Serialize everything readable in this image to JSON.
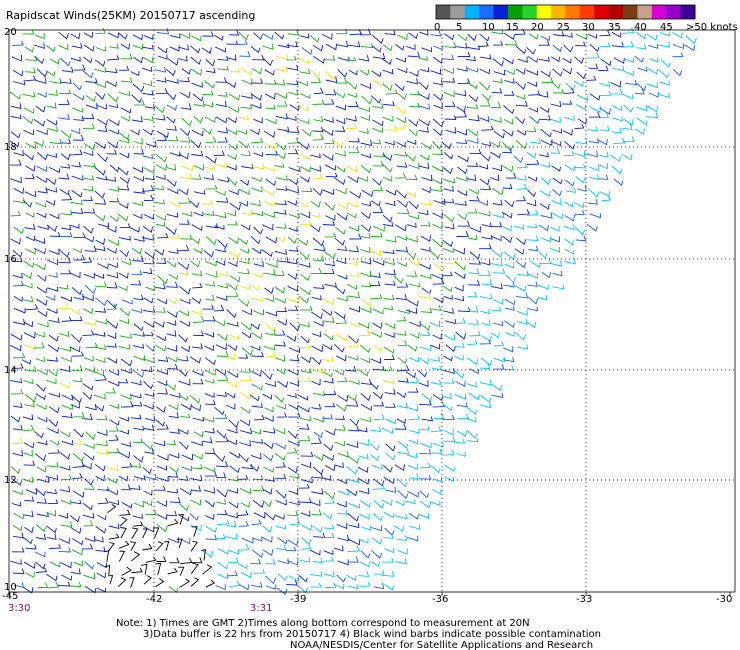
{
  "title": "Rapidscat Winds(25KM) 20150717 ascending",
  "legend": {
    "unit_label": ">50 knots",
    "ticks": [
      "0",
      "5",
      "10",
      "15",
      "20",
      "25",
      "30",
      "35",
      "40",
      "45"
    ],
    "colors": [
      "#555555",
      "#9b9b9b",
      "#00b4ff",
      "#1c6bff",
      "#0a1fd6",
      "#08a008",
      "#25d225",
      "#ffff00",
      "#ffb400",
      "#ff7800",
      "#ff3c00",
      "#e00000",
      "#b40000",
      "#7a3c14",
      "#c8a08c",
      "#d600d6",
      "#9600c8",
      "#3c0096"
    ]
  },
  "map": {
    "lat_labels": [
      "20",
      "18",
      "16",
      "14",
      "12",
      "10"
    ],
    "lon_labels": [
      "-45",
      "-42",
      "-39",
      "-36",
      "-33",
      "-30"
    ],
    "gridlines": "dotted"
  },
  "times": {
    "left": "3:30",
    "middle": "3:31"
  },
  "note": {
    "line1": "Note: 1) Times are GMT 2)Times along bottom correspond to measurement at 20N",
    "line2": "3)Data buffer is 22 hrs from 20150717 4) Black wind barbs indicate possible contamination",
    "line3": "NOAA/NESDIS/Center for Satellite Applications and Research"
  },
  "colors": {
    "low": "#00c8ff",
    "mid_low": "#1f5bff",
    "mid": "#0a1fd6",
    "green": "#18b018",
    "yellow": "#e8e800",
    "contaminated": "#000000"
  }
}
